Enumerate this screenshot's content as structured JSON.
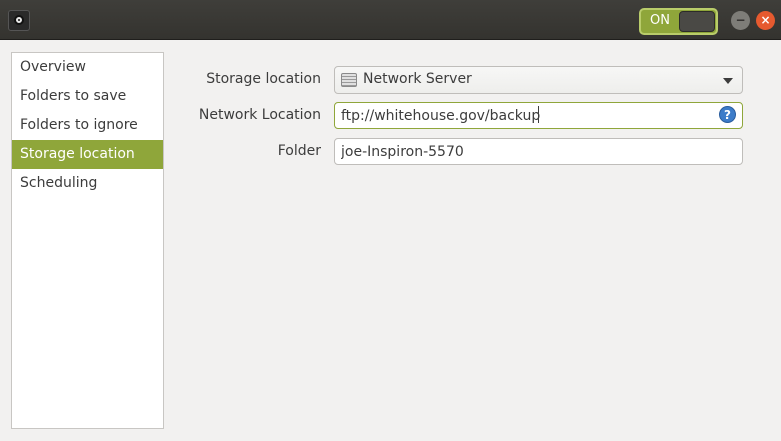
{
  "header": {
    "toggle_label": "ON",
    "icons": {
      "app": "camera-icon",
      "minimize": "minimize-icon",
      "close": "close-icon"
    },
    "accent": "#8fa63a"
  },
  "sidebar": {
    "items": [
      {
        "label": "Overview",
        "active": false
      },
      {
        "label": "Folders to save",
        "active": false
      },
      {
        "label": "Folders to ignore",
        "active": false
      },
      {
        "label": "Storage location",
        "active": true
      },
      {
        "label": "Scheduling",
        "active": false
      }
    ]
  },
  "form": {
    "storage_location": {
      "label": "Storage location",
      "value": "Network Server",
      "icon": "server-icon"
    },
    "network_location": {
      "label": "Network Location",
      "value": "ftp://whitehouse.gov/backup",
      "icon": "help-icon"
    },
    "folder": {
      "label": "Folder",
      "value": "joe-Inspiron-5570"
    }
  }
}
